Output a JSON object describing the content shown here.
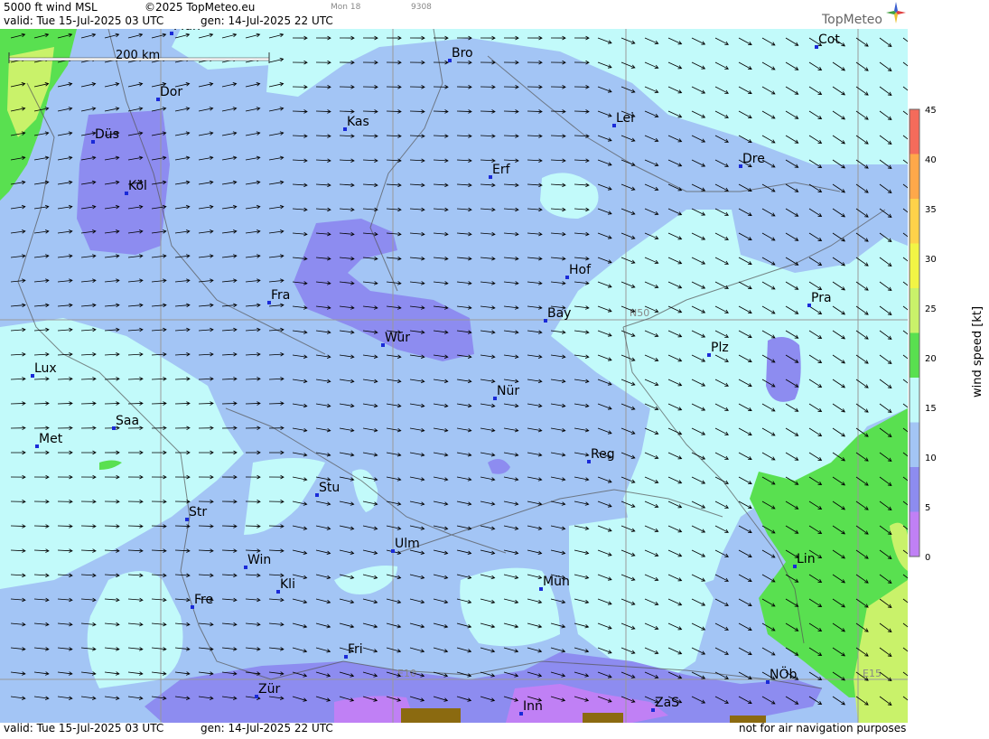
{
  "header": {
    "product": "5000 ft wind MSL",
    "copyright": "©2025 TopMeteo.eu",
    "run_small": "Mon 18",
    "code_small": "9308",
    "valid": "valid:  Tue  15-Jul-2025  03 UTC",
    "gen": "gen: 14-Jul-2025 22 UTC",
    "brand": "TopMeteo"
  },
  "footer": {
    "valid": "valid:  Tue  15-Jul-2025  03 UTC",
    "gen": "gen: 14-Jul-2025 22 UTC",
    "disclaimer": "not for air navigation purposes"
  },
  "scale_bar": {
    "label": "200 km"
  },
  "grid_labels": {
    "lat": "N50",
    "lon1": "E10",
    "lon2": "E15"
  },
  "legend": {
    "title": "wind speed [kt]",
    "ticks": [
      "45",
      "40",
      "35",
      "30",
      "25",
      "20",
      "15",
      "10",
      "5",
      "0"
    ],
    "colors": [
      "#f46b5b",
      "#ffa84a",
      "#ffd24a",
      "#f2f545",
      "#c9f26a",
      "#59e050",
      "#c2fafa",
      "#a3c5f5",
      "#8d8cf0",
      "#c080f5"
    ]
  },
  "cities": [
    {
      "name": "Mün",
      "id": "top"
    },
    {
      "name": "Bro"
    },
    {
      "name": "Cot"
    },
    {
      "name": "Dor"
    },
    {
      "name": "Kas"
    },
    {
      "name": "Lei"
    },
    {
      "name": "Düs"
    },
    {
      "name": "Erf"
    },
    {
      "name": "Dre"
    },
    {
      "name": "Köl"
    },
    {
      "name": "Hof"
    },
    {
      "name": "Fra"
    },
    {
      "name": "Pra"
    },
    {
      "name": "Bay"
    },
    {
      "name": "Wür"
    },
    {
      "name": "Plz"
    },
    {
      "name": "Lux"
    },
    {
      "name": "Nür"
    },
    {
      "name": "Saa"
    },
    {
      "name": "Met"
    },
    {
      "name": "Reg"
    },
    {
      "name": "Stu"
    },
    {
      "name": "Str"
    },
    {
      "name": "Ulm"
    },
    {
      "name": "Win"
    },
    {
      "name": "Lin"
    },
    {
      "name": "Kli"
    },
    {
      "name": "Mün"
    },
    {
      "name": "Fre"
    },
    {
      "name": "Fri"
    },
    {
      "name": "NÖb"
    },
    {
      "name": "Zür"
    },
    {
      "name": "Inn"
    },
    {
      "name": "ZaS"
    }
  ]
}
